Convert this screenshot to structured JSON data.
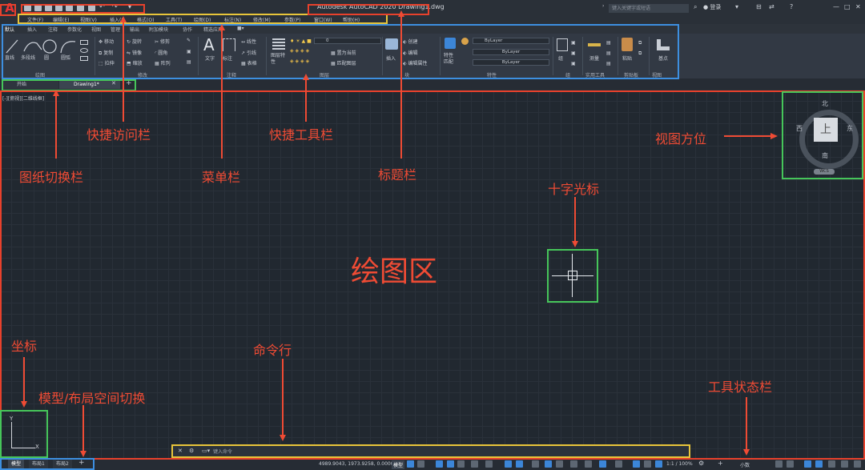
{
  "titlebar": {
    "logo": "A",
    "title": "Autodesk AutoCAD 2020    Drawing1.dwg",
    "search_placeholder": "键入关键字或短语",
    "login": "登录"
  },
  "menubar": {
    "items": [
      "文件(F)",
      "编辑(E)",
      "视图(V)",
      "插入(I)",
      "格式(O)",
      "工具(T)",
      "绘图(D)",
      "标注(N)",
      "修改(M)",
      "参数(P)",
      "窗口(W)",
      "帮助(H)"
    ]
  },
  "ribbon_tabs": [
    "默认",
    "插入",
    "注释",
    "参数化",
    "视图",
    "管理",
    "输出",
    "附加模块",
    "协作",
    "精选应用"
  ],
  "ribbon": {
    "draw_tools": [
      "直线",
      "多段线",
      "圆",
      "圆弧"
    ],
    "modify_tools": [
      "移动",
      "旋转",
      "修剪",
      "复制",
      "镜像",
      "圆角",
      "拉伸",
      "缩放",
      "阵列"
    ],
    "annotation_tools": [
      "文字",
      "标注",
      "线性",
      "引线",
      "表格"
    ],
    "layer_tools": [
      "图层特性",
      "置为当前",
      "匹配图层"
    ],
    "layer_value": "0",
    "block_tools": [
      "插入",
      "创建",
      "编辑",
      "编辑属性"
    ],
    "properties_tools": [
      "特性匹配"
    ],
    "properties_values": [
      "ByLayer",
      "ByLayer",
      "ByLayer"
    ],
    "group_tool": "组",
    "utility_tool": "测量",
    "clipboard_tool": "粘贴",
    "view_tool": "基点",
    "groups": [
      "绘图",
      "修改",
      "注释",
      "图层",
      "块",
      "特性",
      "组",
      "实用工具",
      "剪贴板",
      "视图"
    ]
  },
  "file_tabs": [
    "开始",
    "Drawing1*"
  ],
  "viewport_label": "[-][俯视][二维线框]",
  "viewcube": {
    "face": "上",
    "north": "北",
    "south": "南",
    "east": "东",
    "west": "西",
    "wcs": "WCS"
  },
  "ucs": {
    "x": "X",
    "y": "Y"
  },
  "layout_tabs": [
    "模型",
    "布局1",
    "布局2"
  ],
  "command_line": {
    "placeholder": "键入命令"
  },
  "statusbar": {
    "coords": "4989.9043, 1973.9258, 0.0000",
    "model": "模型",
    "scale": "1:1 / 100%",
    "units": "小数"
  },
  "annotations": {
    "drawing_area": "绘图区",
    "quick_access": "快捷访问栏",
    "tab_switch": "图纸切换栏",
    "menu_bar": "菜单栏",
    "quick_tools": "快捷工具栏",
    "title_bar": "标题栏",
    "view_cube": "视图方位",
    "crosshair": "十字光标",
    "coordinates": "坐标",
    "model_layout": "模型/布局空间切换",
    "command_line": "命令行",
    "status_bar": "工具状态栏"
  },
  "colors": {
    "annotation_red": "#ef4b34",
    "box_blue": "#3d8fe0",
    "box_green": "#46c55a",
    "box_yellow": "#e8c53a",
    "bg": "#212830"
  }
}
